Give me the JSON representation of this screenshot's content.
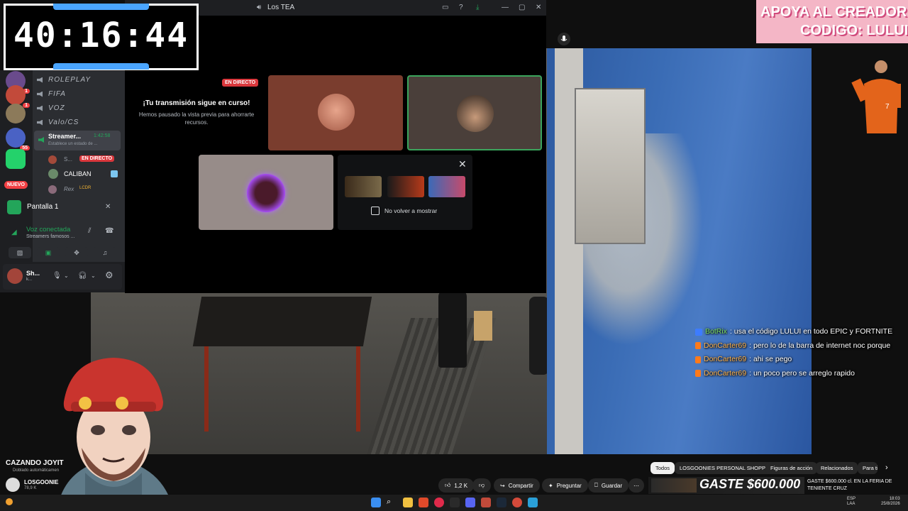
{
  "timer": {
    "value": "40:16:44"
  },
  "promo": {
    "line1": "APOYA AL CREADOR",
    "line2": "CODIGO: LULUI"
  },
  "discord": {
    "window_title": "Los TEA",
    "server_header": "LOS TEA",
    "servers": [
      {
        "count": "1"
      },
      {
        "count": "1"
      },
      {
        "count": ""
      },
      {
        "count": "56"
      },
      {
        "count": "55"
      },
      {
        "count": ""
      }
    ],
    "new_badge": "NUEVO",
    "channels": [
      "ROLEPLAY",
      "FIFA",
      "VOZ",
      "Valo/CS"
    ],
    "stream_channel": {
      "name": "Streamer...",
      "time": "1:42:58",
      "status_placeholder": "Establece un estado de ..."
    },
    "members": [
      {
        "name": "S...",
        "badge": "EN DIRECTO"
      },
      {
        "name": "CALIBAN",
        "badge": ""
      },
      {
        "name": "Rex",
        "badge": "LCDR"
      }
    ],
    "screen_share": "Pantalla 1",
    "voice": {
      "status": "Voz conectada",
      "channel": "Streamers famosos ..."
    },
    "user": {
      "name": "Sh...",
      "sub": "k..."
    },
    "stream": {
      "live_badge": "EN DIRECTO",
      "still_live": "¡Tu transmisión sigue en curso!",
      "paused": "Hemos pausado la vista previa para ahorrarte recursos.",
      "dont_show": "No volver a mostrar"
    }
  },
  "chat": [
    {
      "user": "BotRix",
      "text": ": usa el código LULUI en todo EPIC y FORTNITE",
      "bot": true
    },
    {
      "user": "DonCarter69",
      "text": ": pero lo de la barra de internet noc porque",
      "bot": false
    },
    {
      "user": "DonCarter69",
      "text": ": ahi se pego",
      "bot": false
    },
    {
      "user": "DonCarter69",
      "text": ": un poco pero se arreglo rapido",
      "bot": false
    }
  ],
  "youtube": {
    "video_title": "CAZANDO JOYIT",
    "dub_note": "Doblado automáticamen",
    "channel_name": "LOSGOONIE",
    "channel_subs": "78,9 K",
    "likes": "1,2 K",
    "share": "Compartir",
    "ask": "Preguntar",
    "save": "Guardar",
    "chips": [
      "Todos",
      "LOSGOONIES PERSONAL SHOPPER",
      "Figuras de acción",
      "Relacionados",
      "Para ti"
    ],
    "ad": {
      "big": "GASTE $600.000",
      "text": "GASTE $600.000 cl. EN LA FERIA DE TENIENTE CRUZ"
    }
  },
  "taskbar": {
    "lang_top": "ESP",
    "lang_bottom": "LAA",
    "time": "18:03",
    "date": "25/8/2026"
  },
  "colors": {
    "accent_live": "#da373c",
    "discord_green": "#3ba55c",
    "timer_bar": "#4aa5ff",
    "promo_bg": "#f4b6c6"
  }
}
